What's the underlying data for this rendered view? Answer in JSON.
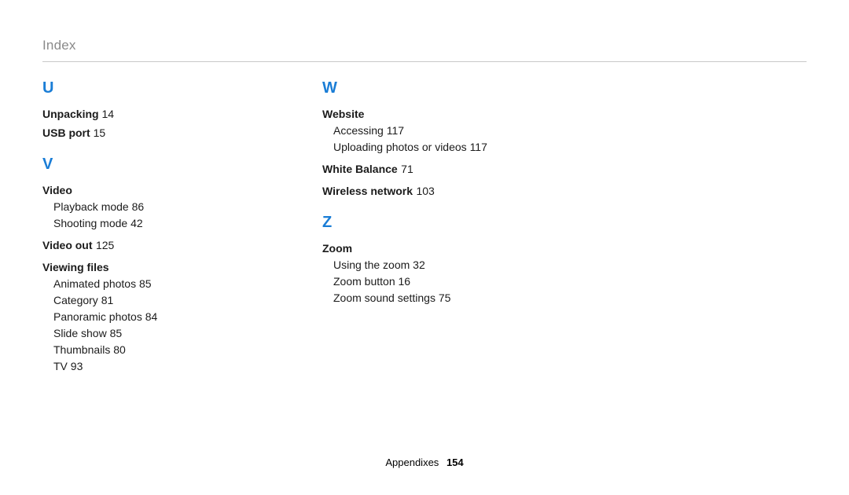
{
  "page_title": "Index",
  "footer": {
    "section": "Appendixes",
    "page": "154"
  },
  "col1": {
    "U": {
      "letter": "U",
      "entries": [
        {
          "text": "Unpacking",
          "page": "14"
        },
        {
          "text": "USB port",
          "page": "15"
        }
      ]
    },
    "V": {
      "letter": "V",
      "groups": [
        {
          "heading": "Video",
          "subs": [
            {
              "text": "Playback mode",
              "page": "86"
            },
            {
              "text": "Shooting mode",
              "page": "42"
            }
          ]
        },
        {
          "heading": "Video out",
          "page": "125"
        },
        {
          "heading": "Viewing files",
          "subs": [
            {
              "text": "Animated photos",
              "page": "85"
            },
            {
              "text": "Category",
              "page": "81"
            },
            {
              "text": "Panoramic photos",
              "page": "84"
            },
            {
              "text": "Slide show",
              "page": "85"
            },
            {
              "text": "Thumbnails",
              "page": "80"
            },
            {
              "text": "TV",
              "page": "93"
            }
          ]
        }
      ]
    }
  },
  "col2": {
    "W": {
      "letter": "W",
      "groups": [
        {
          "heading": "Website",
          "subs": [
            {
              "text": "Accessing",
              "page": "117"
            },
            {
              "text": "Uploading photos or videos",
              "page": "117"
            }
          ]
        },
        {
          "heading": "White Balance",
          "page": "71"
        },
        {
          "heading": "Wireless network",
          "page": "103"
        }
      ]
    },
    "Z": {
      "letter": "Z",
      "groups": [
        {
          "heading": "Zoom",
          "subs": [
            {
              "text": "Using the zoom",
              "page": "32"
            },
            {
              "text": "Zoom button",
              "page": "16"
            },
            {
              "text": "Zoom sound settings",
              "page": "75"
            }
          ]
        }
      ]
    }
  }
}
